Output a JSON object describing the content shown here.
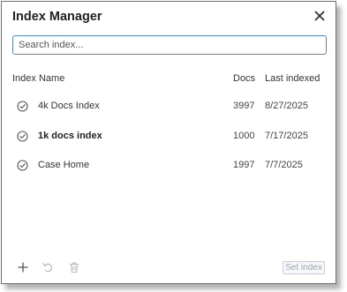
{
  "dialog": {
    "title": "Index Manager",
    "close_icon": "close-icon"
  },
  "search": {
    "placeholder": "Search index...",
    "value": ""
  },
  "table": {
    "headers": {
      "name": "Index Name",
      "docs": "Docs",
      "last_indexed": "Last indexed"
    },
    "rows": [
      {
        "name": "4k Docs Index",
        "docs": "3997",
        "last_indexed": "8/27/2025",
        "bold": false,
        "icon": "check-circle-icon"
      },
      {
        "name": "1k docs index",
        "docs": "1000",
        "last_indexed": "7/17/2025",
        "bold": true,
        "icon": "check-circle-icon"
      },
      {
        "name": "Case Home",
        "docs": "1997",
        "last_indexed": "7/7/2025",
        "bold": false,
        "icon": "check-circle-icon"
      }
    ]
  },
  "footer": {
    "add_icon": "plus-icon",
    "undo_icon": "undo-icon",
    "delete_icon": "trash-icon",
    "set_index_label": "Set index"
  },
  "colors": {
    "border": "#6e6e6e",
    "search_border": "#5a86b5",
    "text": "#333333",
    "muted": "#9aa3ad"
  }
}
